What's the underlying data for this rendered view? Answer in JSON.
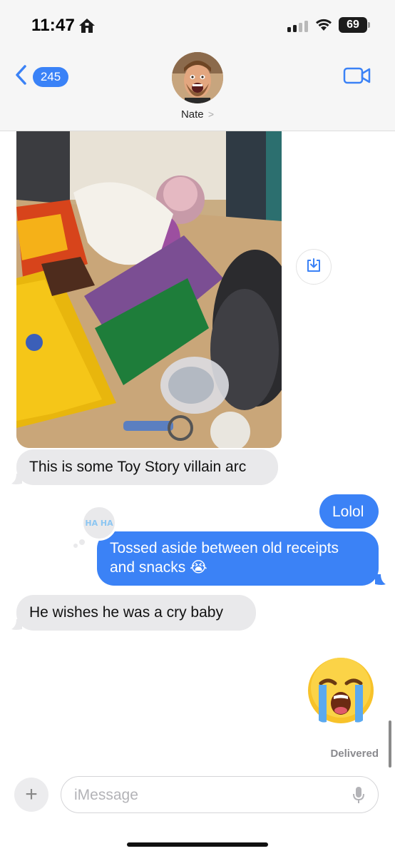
{
  "status_bar": {
    "time": "11:47",
    "battery": "69",
    "signal_bars_active": 2,
    "signal_bars_total": 4
  },
  "header": {
    "back_badge": "245",
    "contact_name": "Nate",
    "contact_chevron": ">"
  },
  "messages": [
    {
      "type": "image",
      "direction": "incoming"
    },
    {
      "type": "text",
      "direction": "incoming",
      "text": "This is some Toy Story villain arc"
    },
    {
      "type": "text",
      "direction": "outgoing",
      "text": "Lolol"
    },
    {
      "type": "text",
      "direction": "outgoing",
      "text": "Tossed aside between old receipts and snacks 😭",
      "tapback": "HA HA"
    },
    {
      "type": "text",
      "direction": "incoming",
      "text": "He wishes he was a cry baby"
    },
    {
      "type": "emoji",
      "direction": "outgoing",
      "text": "😭"
    }
  ],
  "delivery_status": "Delivered",
  "composer": {
    "placeholder": "iMessage",
    "plus_label": "+"
  },
  "icons": {
    "back": "chevron-left-icon",
    "video": "video-camera-icon",
    "save": "download-icon",
    "mic": "microphone-icon",
    "home": "home-icon",
    "wifi": "wifi-icon"
  },
  "colors": {
    "accent": "#3b82f6",
    "incoming_bubble": "#e9e9eb",
    "outgoing_bubble": "#3b82f6"
  }
}
